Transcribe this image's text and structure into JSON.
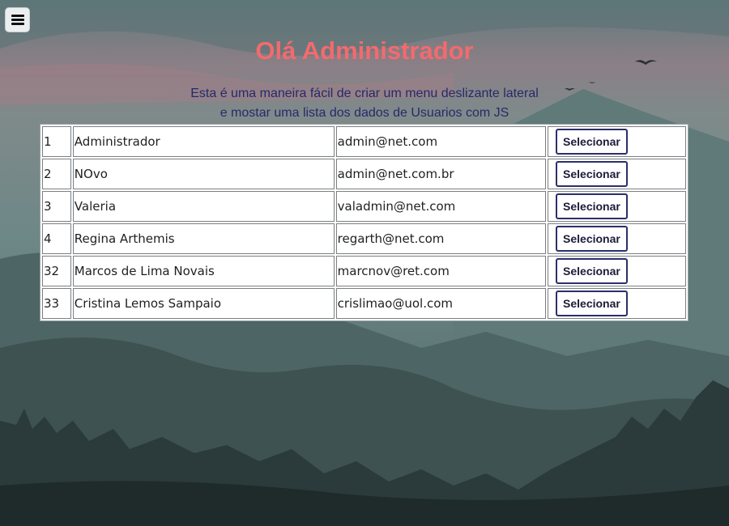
{
  "header": {
    "title": "Olá Administrador",
    "subtitle_line1": "Esta é uma maneira fácil de criar um menu deslizante lateral",
    "subtitle_line2": "e mostar uma lista dos dados de Usuarios com JS"
  },
  "menu": {
    "icon": "hamburger-menu-icon"
  },
  "users": [
    {
      "id": "1",
      "name": "Administrador",
      "email": "admin@net.com",
      "action": "Selecionar"
    },
    {
      "id": "2",
      "name": "NOvo",
      "email": "admin@net.com.br",
      "action": "Selecionar"
    },
    {
      "id": "3",
      "name": "Valeria",
      "email": "valadmin@net.com",
      "action": "Selecionar"
    },
    {
      "id": "4",
      "name": "Regina Arthemis",
      "email": "regarth@net.com",
      "action": "Selecionar"
    },
    {
      "id": "32",
      "name": "Marcos de Lima Novais",
      "email": "marcnov@ret.com",
      "action": "Selecionar"
    },
    {
      "id": "33",
      "name": "Cristina Lemos Sampaio",
      "email": "crislimao@uol.com",
      "action": "Selecionar"
    }
  ],
  "colors": {
    "title": "#f36a6e",
    "subtitle": "#262a6b",
    "button_border": "#2b2f6b"
  }
}
